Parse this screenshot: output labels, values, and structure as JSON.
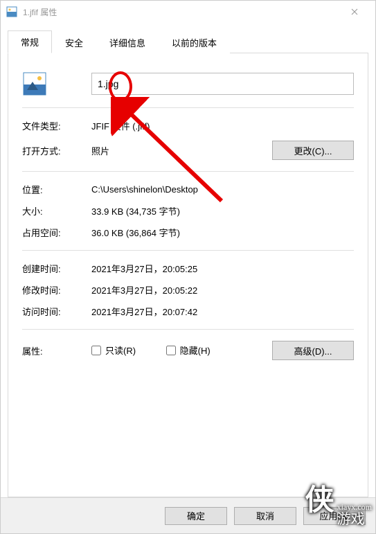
{
  "titlebar": {
    "title": "1.jfif 属性"
  },
  "tabs": [
    {
      "label": "常规"
    },
    {
      "label": "安全"
    },
    {
      "label": "详细信息"
    },
    {
      "label": "以前的版本"
    }
  ],
  "filename_input": {
    "value": "1.jpg"
  },
  "rows": {
    "type_label": "文件类型:",
    "type_value": "JFIF 文件 (.jfif)",
    "openwith_label": "打开方式:",
    "openwith_value": "照片",
    "change_button": "更改(C)...",
    "location_label": "位置:",
    "location_value": "C:\\Users\\shinelon\\Desktop",
    "size_label": "大小:",
    "size_value": "33.9 KB (34,735 字节)",
    "sizedisk_label": "占用空间:",
    "sizedisk_value": "36.0 KB (36,864 字节)",
    "created_label": "创建时间:",
    "created_value": "2021年3月27日，20:05:25",
    "modified_label": "修改时间:",
    "modified_value": "2021年3月27日，20:05:22",
    "accessed_label": "访问时间:",
    "accessed_value": "2021年3月27日，20:07:42",
    "attr_label": "属性:",
    "readonly_label": "只读(R)",
    "hidden_label": "隐藏(H)",
    "advanced_button": "高级(D)..."
  },
  "buttons": {
    "ok": "确定",
    "cancel": "取消",
    "apply": "应用(A)"
  },
  "watermark": {
    "big": "侠",
    "line1": "xiayx.com",
    "line2": "游戏"
  }
}
